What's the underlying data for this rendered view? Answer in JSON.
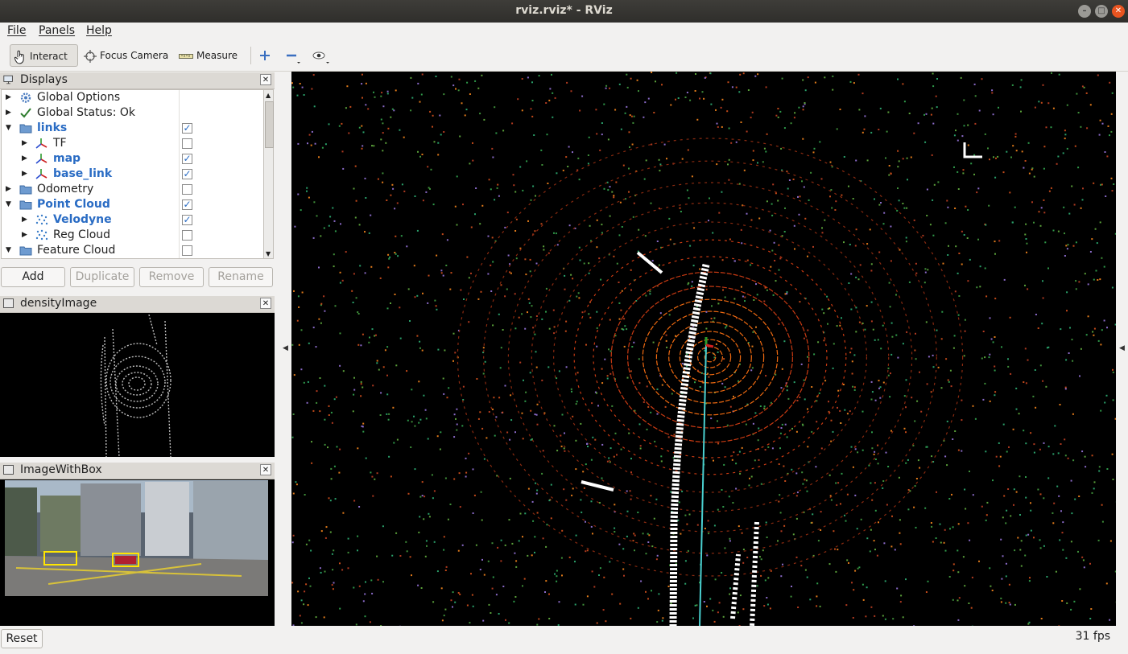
{
  "window": {
    "title": "rviz.rviz* - RViz"
  },
  "menu": [
    "File",
    "Panels",
    "Help"
  ],
  "toolbar": {
    "interact": "Interact",
    "focus_camera": "Focus Camera",
    "measure": "Measure",
    "icons": [
      "crosshair-plus-icon",
      "minus-icon",
      "eye-icon"
    ]
  },
  "displays_panel": {
    "title": "Displays",
    "items": [
      {
        "label": "Global Options",
        "icon": "gear-icon",
        "expanded": false,
        "bold": false,
        "checked": null
      },
      {
        "label": "Global Status: Ok",
        "icon": "check-icon",
        "expanded": false,
        "bold": false,
        "checked": null
      },
      {
        "label": "links",
        "icon": "folder-icon",
        "expanded": true,
        "bold": true,
        "checked": true
      },
      {
        "label": "TF",
        "icon": "axes-icon",
        "expanded": false,
        "bold": false,
        "checked": false
      },
      {
        "label": "map",
        "icon": "axes-icon",
        "expanded": false,
        "bold": true,
        "checked": true
      },
      {
        "label": "base_link",
        "icon": "axes-icon",
        "expanded": false,
        "bold": true,
        "checked": true
      },
      {
        "label": "Odometry",
        "icon": "folder-icon",
        "expanded": false,
        "bold": false,
        "checked": false
      },
      {
        "label": "Point Cloud",
        "icon": "folder-icon",
        "expanded": true,
        "bold": true,
        "checked": true
      },
      {
        "label": "Velodyne",
        "icon": "pointcloud-icon",
        "expanded": false,
        "bold": true,
        "checked": true
      },
      {
        "label": "Reg Cloud",
        "icon": "pointcloud-icon",
        "expanded": false,
        "bold": false,
        "checked": false
      },
      {
        "label": "Feature Cloud",
        "icon": "folder-icon",
        "expanded": true,
        "bold": false,
        "checked": false
      }
    ],
    "buttons": {
      "add": "Add",
      "duplicate": "Duplicate",
      "remove": "Remove",
      "rename": "Rename"
    }
  },
  "density_panel": {
    "title": "densityImage"
  },
  "imagebox_panel": {
    "title": "ImageWithBox"
  },
  "status": {
    "reset": "Reset",
    "fps": "31 fps"
  }
}
